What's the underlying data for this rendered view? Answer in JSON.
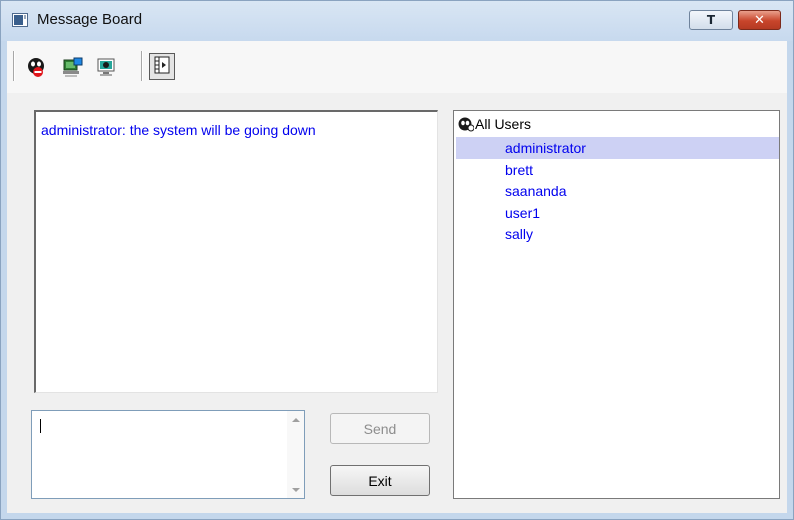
{
  "window": {
    "title": "Message Board",
    "minimize_glyph": "T",
    "close_glyph": "✕"
  },
  "toolbar": {
    "tools": [
      {
        "icon": "do-not-disturb-icon"
      },
      {
        "icon": "broadcast-computer-icon"
      },
      {
        "icon": "user-computer-icon"
      },
      {
        "icon": "panel-toggle-icon",
        "pressed": true
      }
    ]
  },
  "messages": [
    {
      "text": "administrator: the system will be going down"
    }
  ],
  "users": {
    "root_label": "All Users",
    "items": [
      "administrator",
      "brett",
      "saananda",
      "user1",
      "sally"
    ],
    "selected_index": 0
  },
  "compose": {
    "value": ""
  },
  "buttons": {
    "send_label": "Send",
    "exit_label": "Exit"
  },
  "colors": {
    "message_text": "#0000ee",
    "selection": "#cdd1f4",
    "close_button": "#c8452b"
  }
}
